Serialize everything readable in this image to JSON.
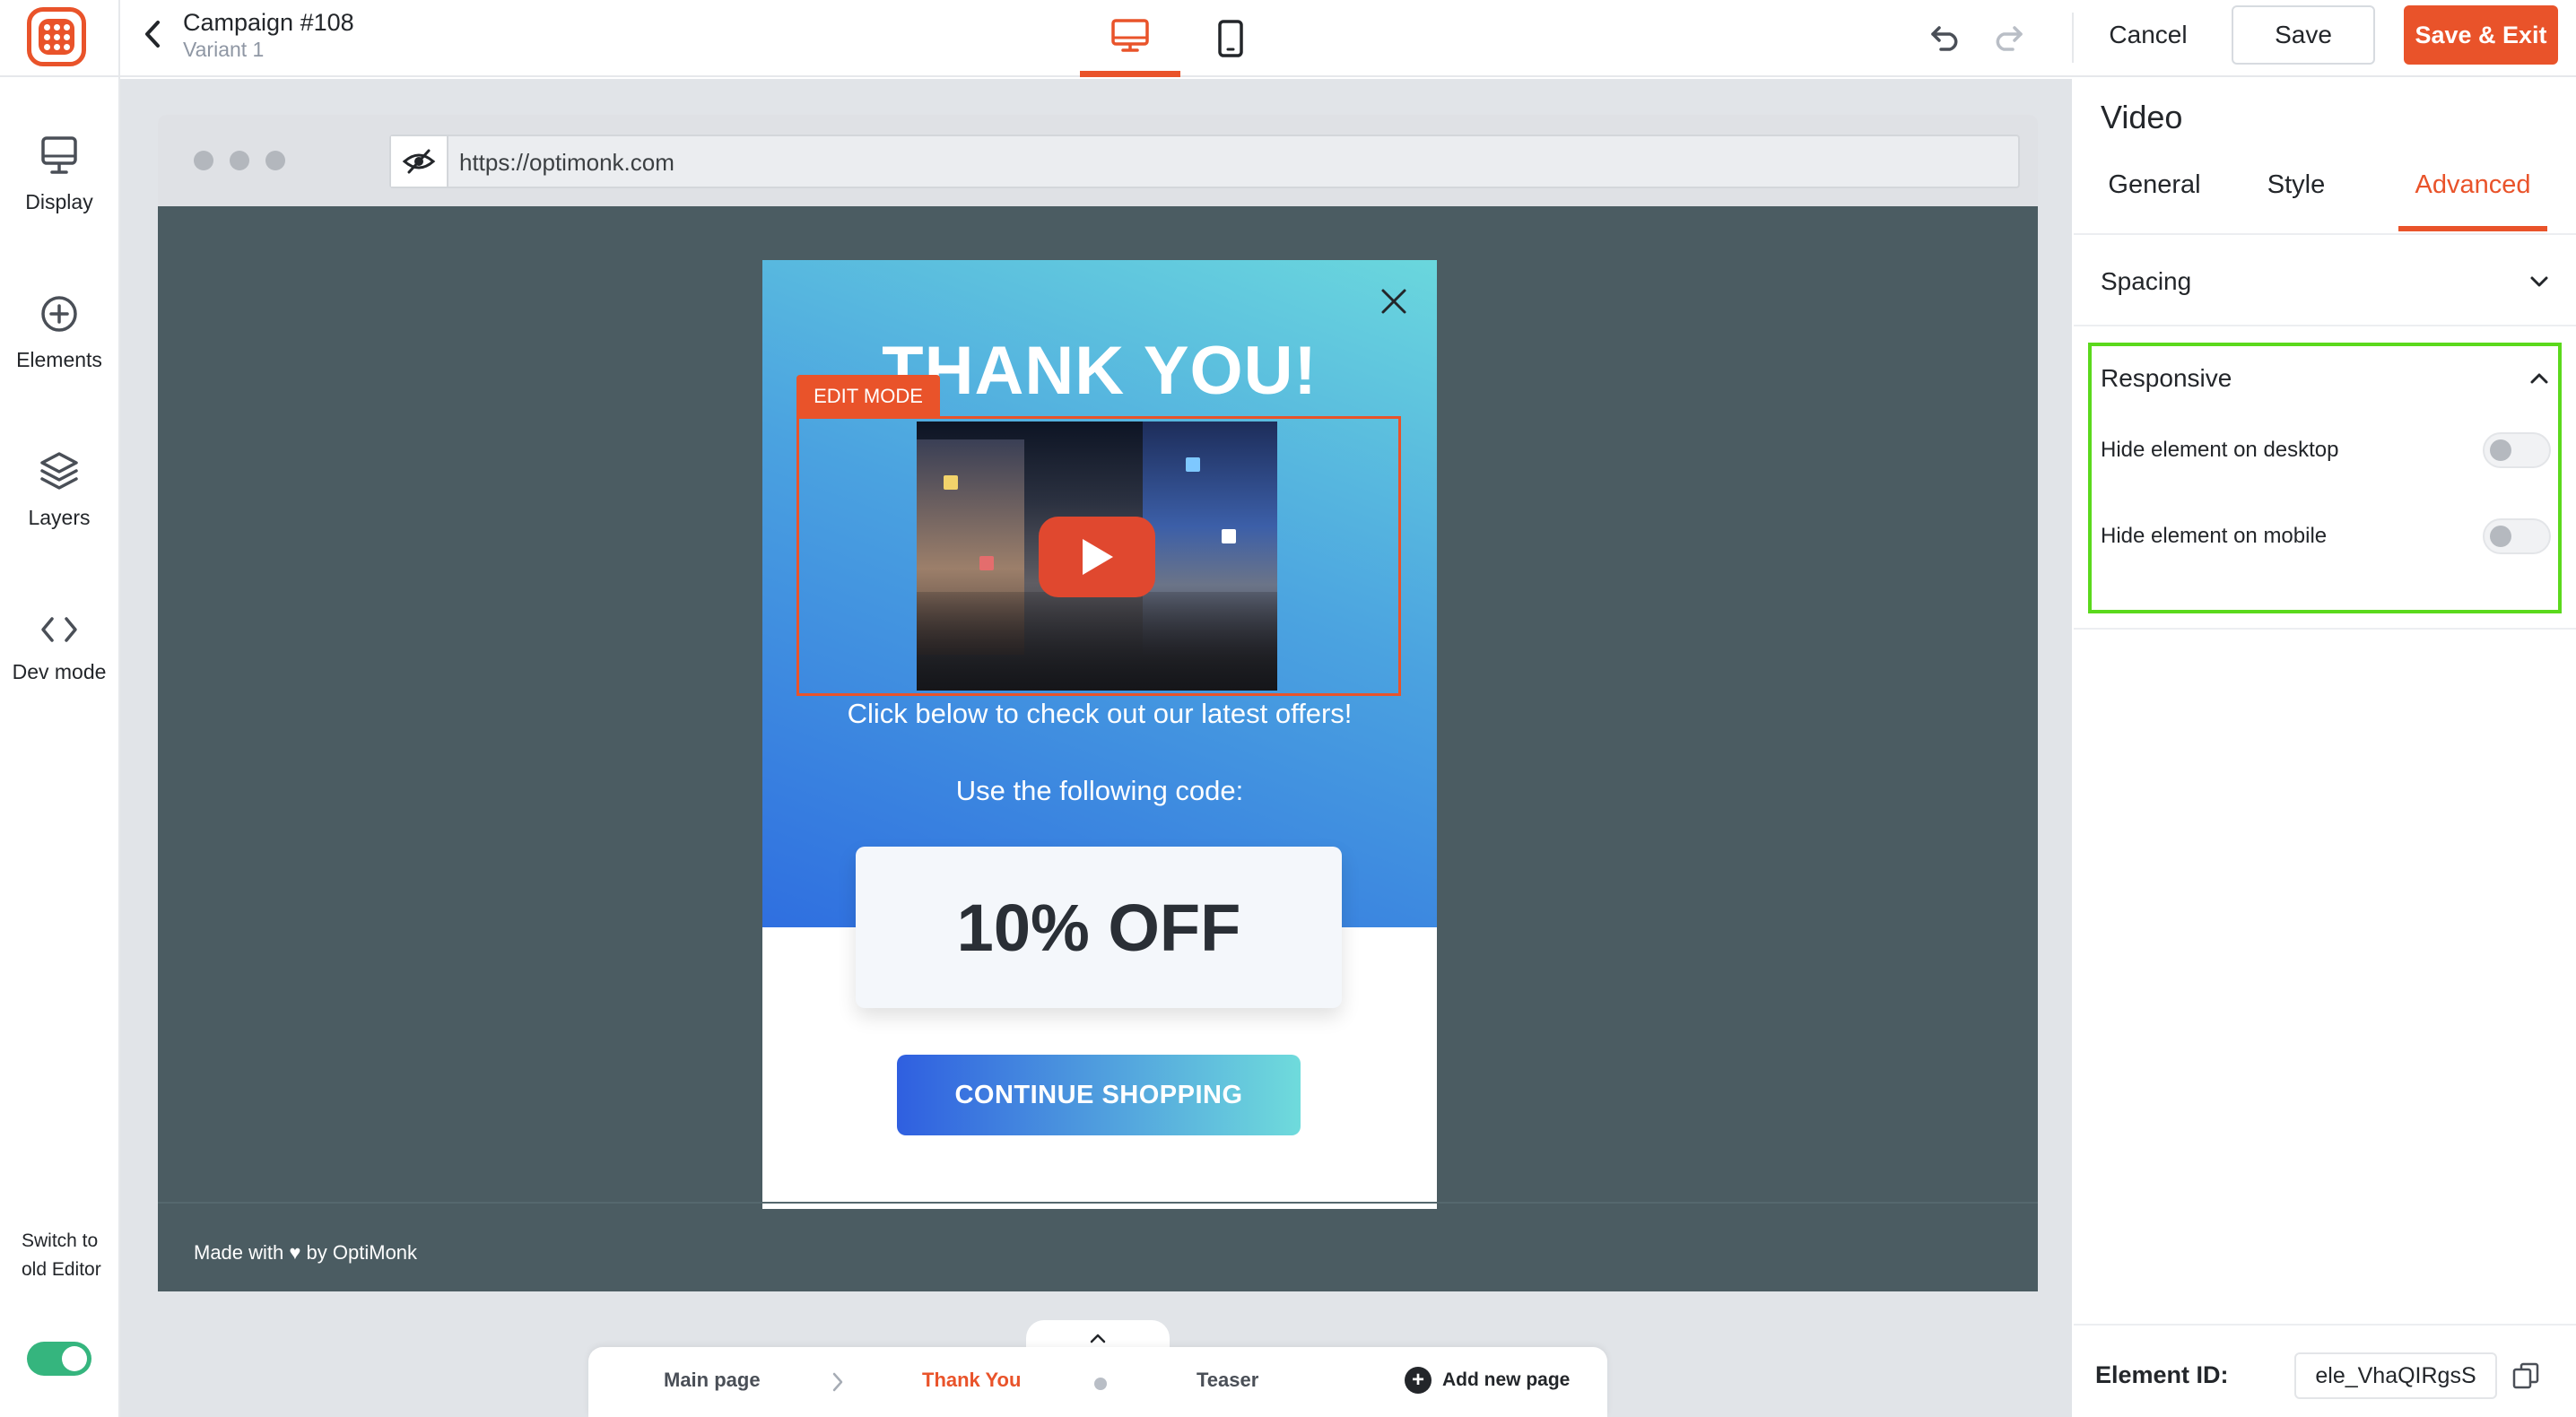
{
  "header": {
    "campaign_title": "Campaign #108",
    "variant": "Variant 1",
    "cancel_label": "Cancel",
    "save_label": "Save",
    "save_exit_label": "Save & Exit",
    "active_device": "desktop",
    "accent_color": "#e9532a"
  },
  "sidebar": {
    "items": [
      {
        "label": "Display",
        "icon": "monitor-icon"
      },
      {
        "label": "Elements",
        "icon": "plus-circle-icon"
      },
      {
        "label": "Layers",
        "icon": "layers-icon"
      },
      {
        "label": "Dev mode",
        "icon": "code-icon"
      }
    ],
    "switch_label": "Switch to old Editor",
    "switch_on": true
  },
  "browser": {
    "url": "https://optimonk.com",
    "footer_text": "Made with ♥ by OptiMonk"
  },
  "popup": {
    "title": "THANK YOU!",
    "edit_mode_label": "EDIT MODE",
    "subtitle": "Click below to check out our latest offers!",
    "code_label": "Use the following code:",
    "code": "10% OFF",
    "cta_label": "CONTINUE SHOPPING"
  },
  "pages": {
    "tabs": [
      "Main page",
      "Thank You",
      "Teaser"
    ],
    "active": "Thank You",
    "add_label": "Add new page"
  },
  "panel": {
    "title": "Video",
    "tabs": [
      "General",
      "Style",
      "Advanced"
    ],
    "active_tab": "Advanced",
    "spacing_label": "Spacing",
    "responsive_label": "Responsive",
    "hide_desktop_label": "Hide element on desktop",
    "hide_mobile_label": "Hide element on mobile",
    "hide_desktop_on": false,
    "hide_mobile_on": false,
    "element_id_label": "Element ID:",
    "element_id": "ele_VhaQIRgsS"
  }
}
